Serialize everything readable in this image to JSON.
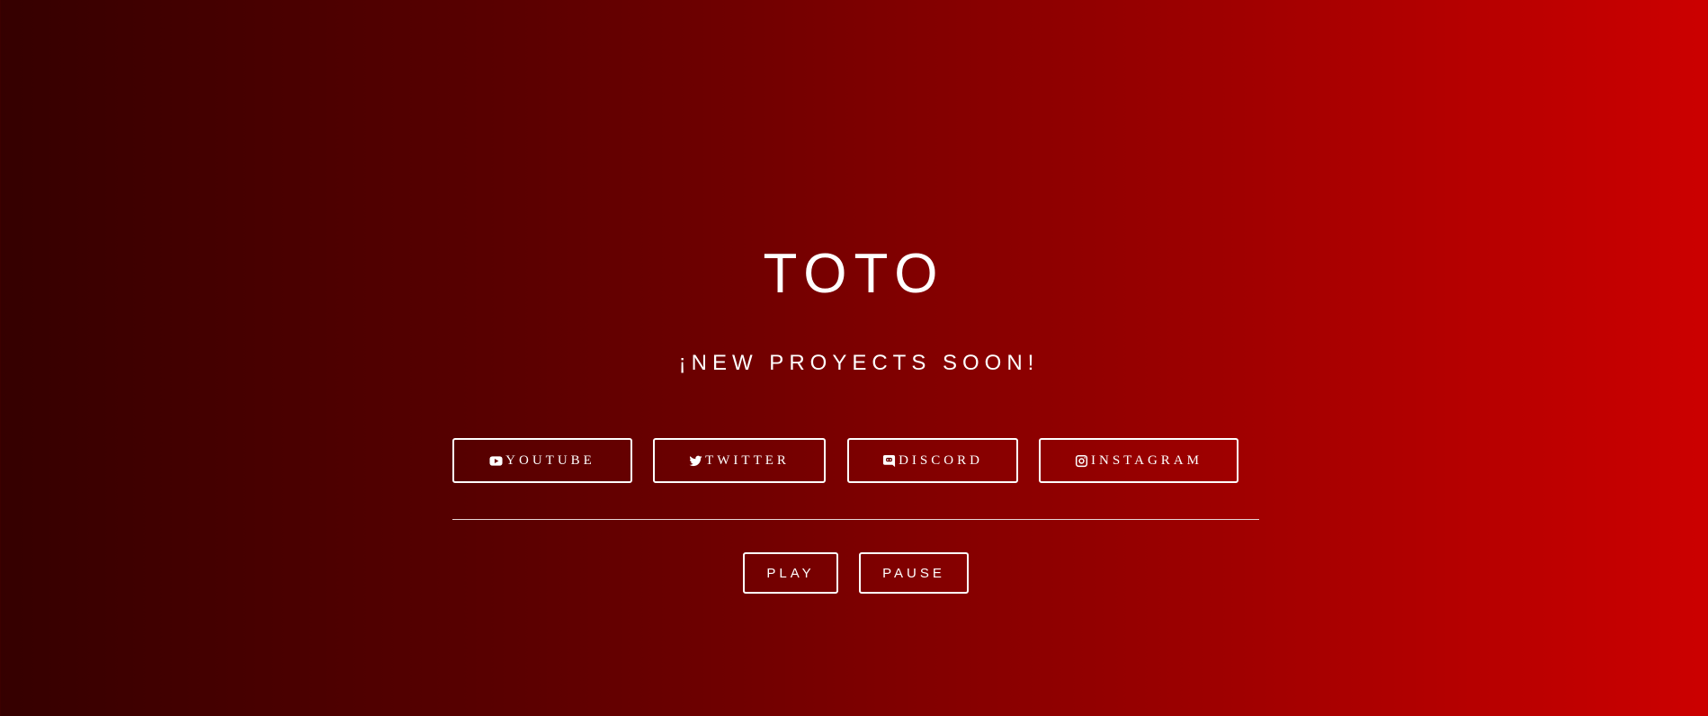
{
  "header": {
    "title": "TOTO",
    "subtitle": "¡NEW PROYECTS SOON!"
  },
  "social": {
    "youtube": {
      "label": "YOUTUBE",
      "icon": "youtube-icon"
    },
    "twitter": {
      "label": "TWITTER",
      "icon": "twitter-icon"
    },
    "discord": {
      "label": "DISCORD",
      "icon": "discord-icon"
    },
    "instagram": {
      "label": "INSTAGRAM",
      "icon": "instagram-icon"
    }
  },
  "player": {
    "play_label": "PLAY",
    "pause_label": "PAUSE"
  },
  "colors": {
    "gradient_start": "#350000",
    "gradient_end": "#cc0000",
    "text": "#ffffff"
  }
}
